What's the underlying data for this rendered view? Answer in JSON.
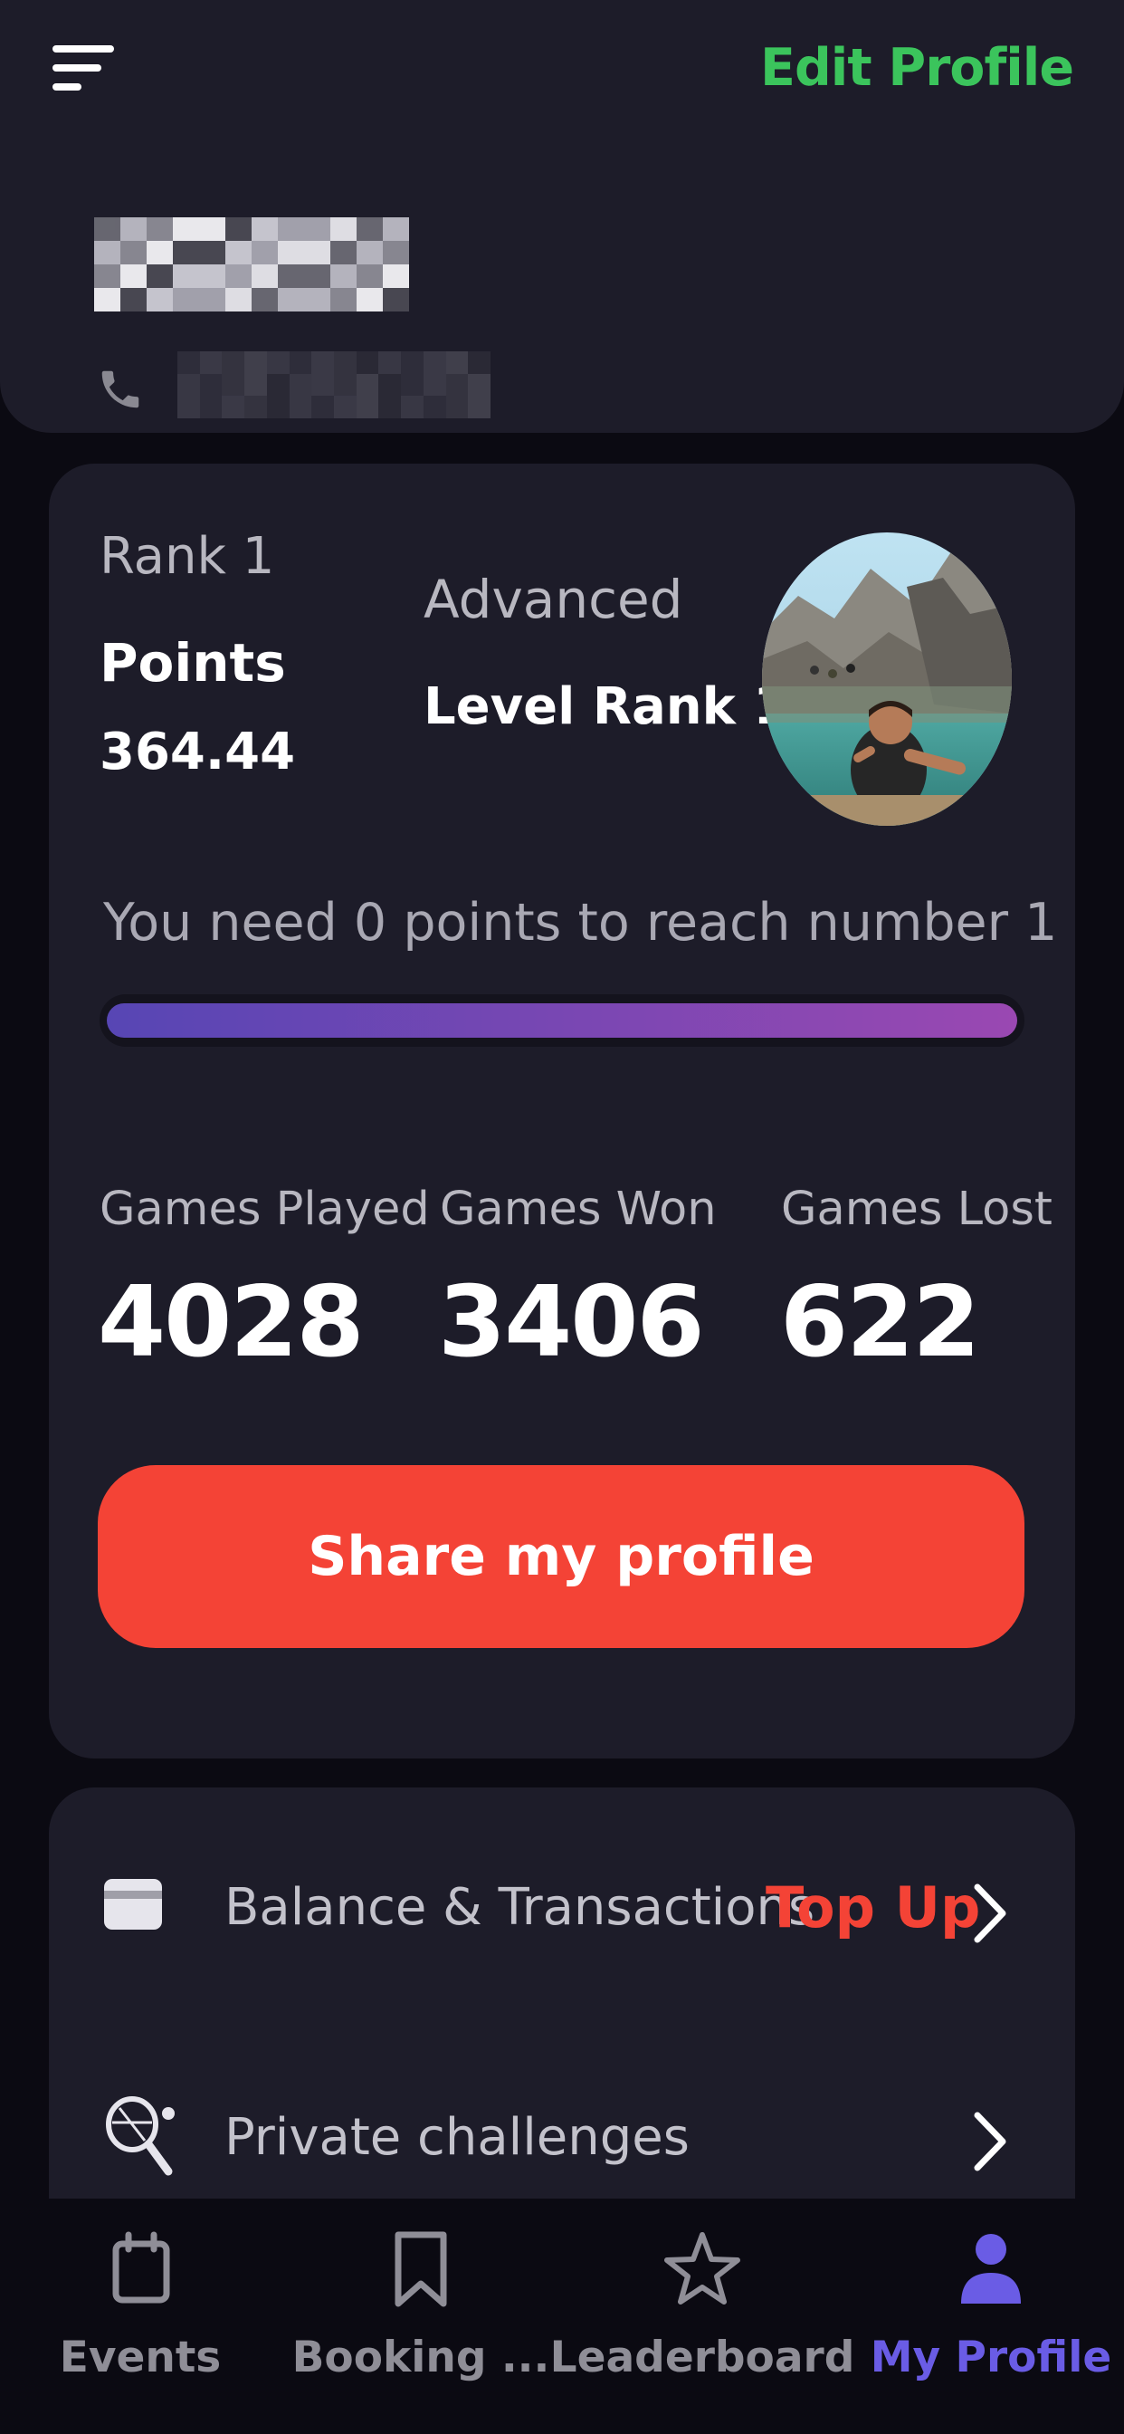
{
  "header": {
    "edit_profile_label": "Edit Profile",
    "menu_icon": "hamburger-menu-icon",
    "phone_icon": "phone-icon"
  },
  "stats": {
    "rank_label": "Rank 1",
    "points_label": "Points",
    "points_value": "364.44",
    "level_label": "Advanced",
    "level_rank": "Level Rank 1",
    "progress_text": "You need 0 points to reach number 1",
    "progress_fraction": 1.0,
    "games": [
      {
        "label": "Games Played",
        "value": "4028"
      },
      {
        "label": "Games Won",
        "value": "3406"
      },
      {
        "label": "Games Lost",
        "value": "622"
      }
    ],
    "share_label": "Share my profile"
  },
  "menu": {
    "items": [
      {
        "label": "Balance & Transactions",
        "action": "Top Up",
        "icon": "card-icon"
      },
      {
        "label": "Private challenges",
        "icon": "tennis-racket-icon"
      }
    ]
  },
  "bottom_nav": {
    "items": [
      {
        "label": "Events",
        "icon": "calendar-icon",
        "active": false
      },
      {
        "label": "Booking ...",
        "icon": "bookmark-icon",
        "active": false
      },
      {
        "label": "Leaderboard",
        "icon": "star-icon",
        "active": false
      },
      {
        "label": "My Profile",
        "icon": "person-icon",
        "active": true
      }
    ]
  },
  "colors": {
    "background": "#0b0a12",
    "card": "#1d1c29",
    "accent_green": "#3bc45c",
    "accent_red": "#f44336",
    "accent_purple": "#6a5ce5"
  }
}
